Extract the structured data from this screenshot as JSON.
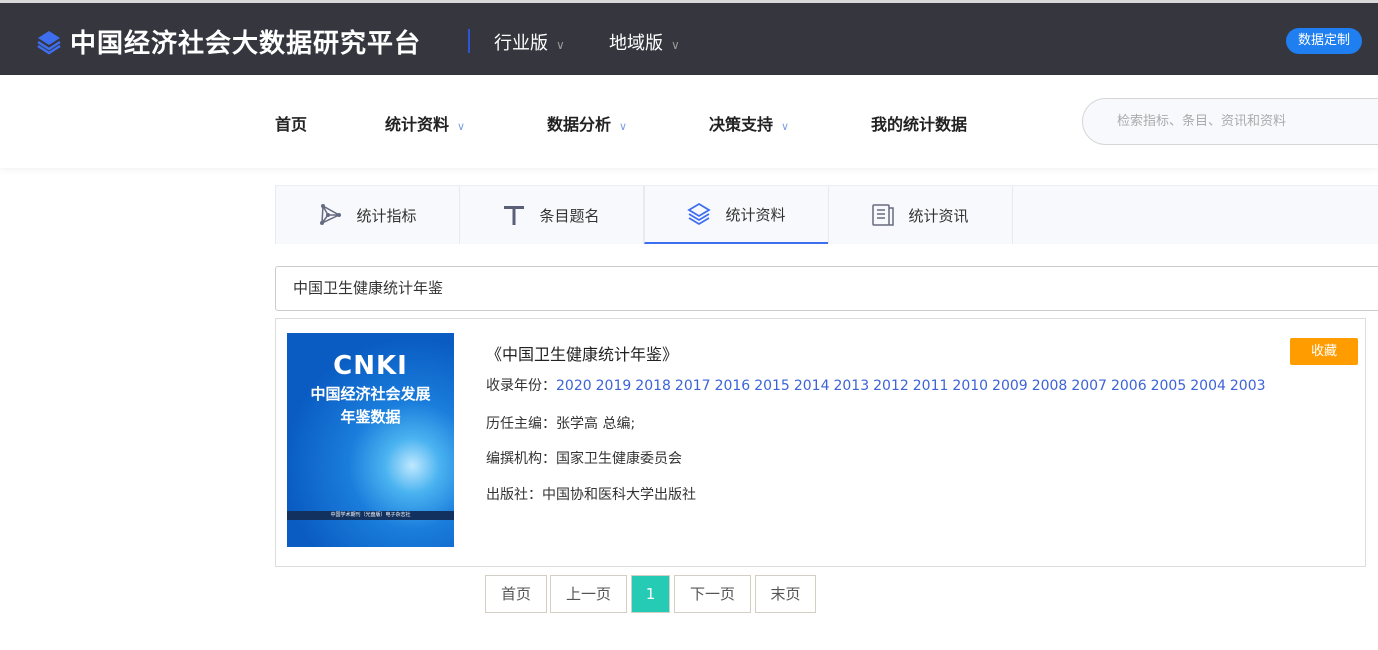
{
  "header": {
    "title": "中国经济社会大数据研究平台",
    "nav": [
      "行业版",
      "地域版"
    ],
    "custom_button": "数据定制"
  },
  "main_nav": {
    "items": [
      "首页",
      "统计资料",
      "数据分析",
      "决策支持",
      "我的统计数据"
    ],
    "search_placeholder": "检索指标、条目、资讯和资料"
  },
  "tabs": [
    {
      "label": "统计指标",
      "icon": "network-icon"
    },
    {
      "label": "条目题名",
      "icon": "text-t-icon"
    },
    {
      "label": "统计资料",
      "icon": "layers-icon",
      "active": true
    },
    {
      "label": "统计资讯",
      "icon": "document-icon"
    }
  ],
  "query": "中国卫生健康统计年鉴",
  "result": {
    "cover": {
      "brand": "CNKI",
      "line1": "中国经济社会发展",
      "line2": "年鉴数据",
      "footer": "中国学术期刊（光盘版）电子杂志社"
    },
    "title": "《中国卫生健康统计年鉴》",
    "years_label": "收录年份：",
    "years": [
      "2020",
      "2019",
      "2018",
      "2017",
      "2016",
      "2015",
      "2014",
      "2013",
      "2012",
      "2011",
      "2010",
      "2009",
      "2008",
      "2007",
      "2006",
      "2005",
      "2004",
      "2003"
    ],
    "editor": "历任主编：张学高 总编;",
    "org": "编撰机构：国家卫生健康委员会",
    "publisher": "出版社：中国协和医科大学出版社",
    "favorite": "收藏"
  },
  "pagination": {
    "first": "首页",
    "prev": "上一页",
    "current": "1",
    "next": "下一页",
    "last": "末页"
  },
  "colors": {
    "topbar": "#36363f",
    "accent": "#3e6ef0",
    "favorite": "#ff9c00",
    "current_page": "#26cbb5"
  }
}
